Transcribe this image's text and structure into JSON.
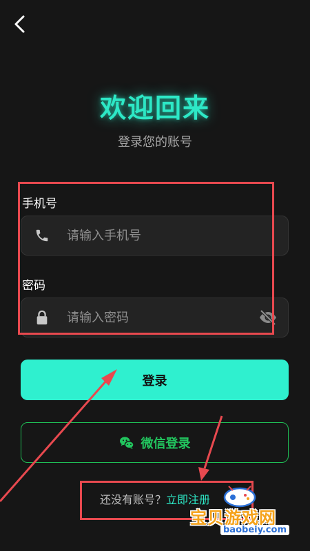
{
  "header": {
    "title": "欢迎回来",
    "subtitle": "登录您的账号"
  },
  "form": {
    "phone_label": "手机号",
    "phone_placeholder": "请输入手机号",
    "password_label": "密码",
    "password_placeholder": "请输入密码"
  },
  "buttons": {
    "login_label": "登录",
    "wechat_label": "微信登录"
  },
  "register": {
    "prompt": "还没有账号？",
    "link": "立即注册"
  },
  "icons": {
    "back": "chevron-left-icon",
    "phone": "phone-icon",
    "lock": "lock-icon",
    "visibility": "eye-off-icon",
    "wechat": "wechat-icon"
  },
  "colors": {
    "background": "#161616",
    "accent": "#2de8c6",
    "login_button": "#2ff0cf",
    "wechat_green": "#22c55e",
    "annotation_red": "#e8494f"
  },
  "watermark": {
    "title": "宝贝游戏网",
    "url": "baobeiy.com"
  }
}
